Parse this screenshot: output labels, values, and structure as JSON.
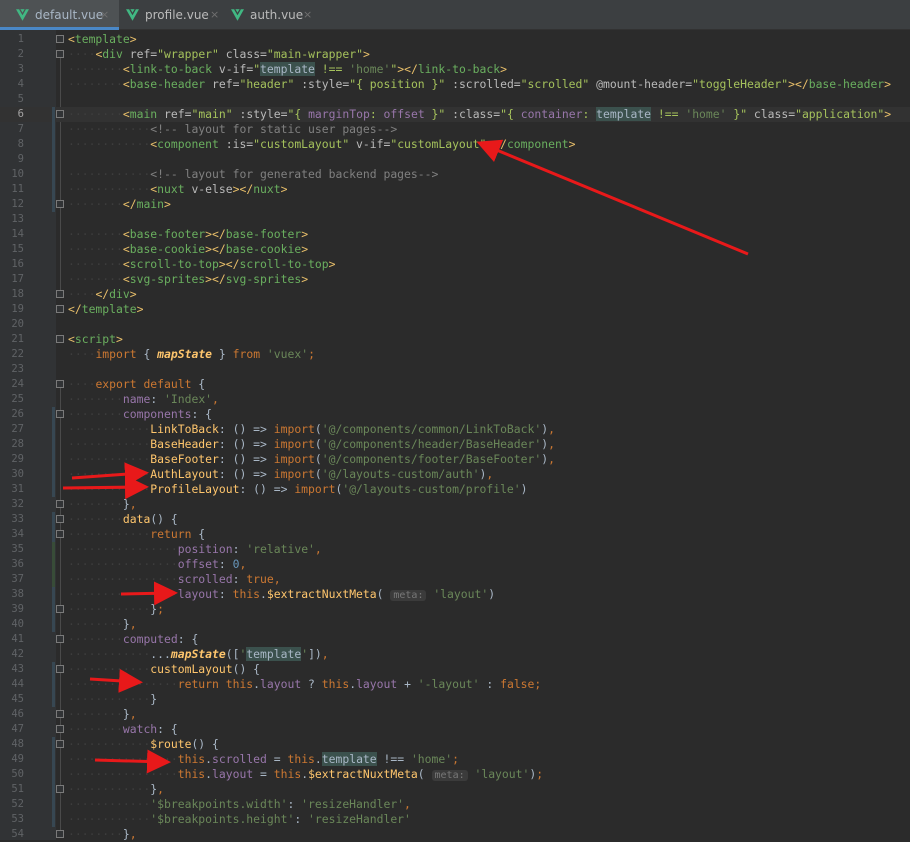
{
  "tabs": [
    {
      "label": "default.vue",
      "active": true
    },
    {
      "label": "profile.vue",
      "active": false
    },
    {
      "label": "auth.vue",
      "active": false
    }
  ],
  "close_glyph": "×",
  "colors": {
    "accent": "#4a88c7",
    "vue_green": "#41b883",
    "arrow": "#e8191a"
  },
  "editor": {
    "line_numbers": [
      "1",
      "2",
      "3",
      "4",
      "5",
      "6",
      "7",
      "8",
      "9",
      "10",
      "11",
      "12",
      "13",
      "14",
      "15",
      "16",
      "17",
      "18",
      "19",
      "20",
      "21",
      "22",
      "23",
      "24",
      "25",
      "26",
      "27",
      "28",
      "29",
      "30",
      "31",
      "32",
      "33",
      "34",
      "35",
      "36",
      "37",
      "38",
      "39",
      "40",
      "41",
      "42",
      "43",
      "44",
      "45",
      "46",
      "47",
      "48",
      "49",
      "50",
      "51",
      "52",
      "53",
      "54"
    ],
    "lines": [
      [
        [
          "tg",
          "<"
        ],
        [
          "tgn",
          "template"
        ],
        [
          "tg",
          ">"
        ]
      ],
      [
        [
          "ws",
          "····"
        ],
        [
          "tg",
          "<"
        ],
        [
          "tgn",
          "div "
        ],
        [
          "an",
          "ref="
        ],
        [
          "av",
          "\"wrapper\""
        ],
        [
          "an",
          " class="
        ],
        [
          "av",
          "\"main-wrapper\""
        ],
        [
          "tg",
          ">"
        ]
      ],
      [
        [
          "ws",
          "········"
        ],
        [
          "tg",
          "<"
        ],
        [
          "tgn",
          "link-to-back "
        ],
        [
          "an",
          "v-if="
        ],
        [
          "av",
          "\""
        ],
        [
          "hl",
          "template"
        ],
        [
          "av",
          " !== "
        ],
        [
          "st",
          "'home'"
        ],
        [
          "av",
          "\""
        ],
        [
          "tg",
          "></"
        ],
        [
          "tgn",
          "link-to-back"
        ],
        [
          "tg",
          ">"
        ]
      ],
      [
        [
          "ws",
          "········"
        ],
        [
          "tg",
          "<"
        ],
        [
          "tgn",
          "base-header "
        ],
        [
          "an",
          "ref="
        ],
        [
          "av",
          "\"header\""
        ],
        [
          "an",
          " :style="
        ],
        [
          "av",
          "\"{ position }\""
        ],
        [
          "an",
          " :scrolled="
        ],
        [
          "av",
          "\"scrolled\""
        ],
        [
          "an",
          " @mount-header="
        ],
        [
          "av",
          "\"toggleHeader\""
        ],
        [
          "tg",
          "></"
        ],
        [
          "tgn",
          "base-header"
        ],
        [
          "tg",
          ">"
        ]
      ],
      [],
      [
        [
          "ws",
          "········"
        ],
        [
          "tg",
          "<"
        ],
        [
          "tgn",
          "main "
        ],
        [
          "an",
          "ref="
        ],
        [
          "av",
          "\"main\""
        ],
        [
          "an",
          " :style="
        ],
        [
          "av",
          "\"{ "
        ],
        [
          "pr",
          "marginTop"
        ],
        [
          "av",
          ": "
        ],
        [
          "pr",
          "offset"
        ],
        [
          "av",
          " }\""
        ],
        [
          "an",
          " :class="
        ],
        [
          "av",
          "\"{ "
        ],
        [
          "pr",
          "container"
        ],
        [
          "av",
          ": "
        ],
        [
          "hl",
          "template"
        ],
        [
          "av",
          " !== "
        ],
        [
          "st",
          "'home'"
        ],
        [
          "av",
          " }\""
        ],
        [
          "an",
          " class="
        ],
        [
          "av",
          "\"application\""
        ],
        [
          "tg",
          ">"
        ]
      ],
      [
        [
          "ws",
          "············"
        ],
        [
          "cm",
          "<!-- layout for static user pages-->"
        ]
      ],
      [
        [
          "ws",
          "············"
        ],
        [
          "tg",
          "<"
        ],
        [
          "tgn",
          "component "
        ],
        [
          "an",
          ":is="
        ],
        [
          "av",
          "\"customLayout\""
        ],
        [
          "an",
          " v-if="
        ],
        [
          "av",
          "\"customLayout\""
        ],
        [
          "tg",
          "></"
        ],
        [
          "tgn",
          "component"
        ],
        [
          "tg",
          ">"
        ]
      ],
      [],
      [
        [
          "ws",
          "············"
        ],
        [
          "cm",
          "<!-- layout for generated backend pages-->"
        ]
      ],
      [
        [
          "ws",
          "············"
        ],
        [
          "tg",
          "<"
        ],
        [
          "tgn",
          "nuxt "
        ],
        [
          "an",
          "v-else"
        ],
        [
          "tg",
          "></"
        ],
        [
          "tgn",
          "nuxt"
        ],
        [
          "tg",
          ">"
        ]
      ],
      [
        [
          "ws",
          "········"
        ],
        [
          "tg",
          "</"
        ],
        [
          "tgn",
          "main"
        ],
        [
          "tg",
          ">"
        ]
      ],
      [],
      [
        [
          "ws",
          "········"
        ],
        [
          "tg",
          "<"
        ],
        [
          "tgn",
          "base-footer"
        ],
        [
          "tg",
          "></"
        ],
        [
          "tgn",
          "base-footer"
        ],
        [
          "tg",
          ">"
        ]
      ],
      [
        [
          "ws",
          "········"
        ],
        [
          "tg",
          "<"
        ],
        [
          "tgn",
          "base-cookie"
        ],
        [
          "tg",
          "></"
        ],
        [
          "tgn",
          "base-cookie"
        ],
        [
          "tg",
          ">"
        ]
      ],
      [
        [
          "ws",
          "········"
        ],
        [
          "tg",
          "<"
        ],
        [
          "tgn",
          "scroll-to-top"
        ],
        [
          "tg",
          "></"
        ],
        [
          "tgn",
          "scroll-to-top"
        ],
        [
          "tg",
          ">"
        ]
      ],
      [
        [
          "ws",
          "········"
        ],
        [
          "tg",
          "<"
        ],
        [
          "tgn",
          "svg-sprites"
        ],
        [
          "tg",
          "></"
        ],
        [
          "tgn",
          "svg-sprites"
        ],
        [
          "tg",
          ">"
        ]
      ],
      [
        [
          "ws",
          "····"
        ],
        [
          "tg",
          "</"
        ],
        [
          "tgn",
          "div"
        ],
        [
          "tg",
          ">"
        ]
      ],
      [
        [
          "tg",
          "</"
        ],
        [
          "tgn",
          "template"
        ],
        [
          "tg",
          ">"
        ]
      ],
      [],
      [
        [
          "tg",
          "<"
        ],
        [
          "tgn",
          "script"
        ],
        [
          "tg",
          ">"
        ]
      ],
      [
        [
          "ws",
          "····"
        ],
        [
          "kw",
          "import"
        ],
        [
          "tx",
          " { "
        ],
        [
          "it",
          "mapState"
        ],
        [
          "tx",
          " } "
        ],
        [
          "kw",
          "from"
        ],
        [
          "st",
          " 'vuex'"
        ],
        [
          "kw",
          ";"
        ]
      ],
      [],
      [
        [
          "ws",
          "····"
        ],
        [
          "kw",
          "export default"
        ],
        [
          "tx",
          " {"
        ]
      ],
      [
        [
          "ws",
          "········"
        ],
        [
          "pr",
          "name"
        ],
        [
          "tx",
          ": "
        ],
        [
          "st",
          "'Index'"
        ],
        [
          "kw",
          ","
        ]
      ],
      [
        [
          "ws",
          "········"
        ],
        [
          "pr",
          "components"
        ],
        [
          "tx",
          ": {"
        ]
      ],
      [
        [
          "ws",
          "············"
        ],
        [
          "fn",
          "LinkToBack"
        ],
        [
          "tx",
          ": () => "
        ],
        [
          "kw",
          "import"
        ],
        [
          "tx",
          "("
        ],
        [
          "st",
          "'@/components/common/LinkToBack'"
        ],
        [
          "tx",
          ")"
        ],
        [
          "kw",
          ","
        ]
      ],
      [
        [
          "ws",
          "············"
        ],
        [
          "fn",
          "BaseHeader"
        ],
        [
          "tx",
          ": () => "
        ],
        [
          "kw",
          "import"
        ],
        [
          "tx",
          "("
        ],
        [
          "st",
          "'@/components/header/BaseHeader'"
        ],
        [
          "tx",
          ")"
        ],
        [
          "kw",
          ","
        ]
      ],
      [
        [
          "ws",
          "············"
        ],
        [
          "fn",
          "BaseFooter"
        ],
        [
          "tx",
          ": () => "
        ],
        [
          "kw",
          "import"
        ],
        [
          "tx",
          "("
        ],
        [
          "st",
          "'@/components/footer/BaseFooter'"
        ],
        [
          "tx",
          ")"
        ],
        [
          "kw",
          ","
        ]
      ],
      [
        [
          "ws",
          "············"
        ],
        [
          "fn",
          "AuthLayout"
        ],
        [
          "tx",
          ": () => "
        ],
        [
          "kw",
          "import"
        ],
        [
          "tx",
          "("
        ],
        [
          "st",
          "'@/layouts-custom/auth'"
        ],
        [
          "tx",
          ")"
        ],
        [
          "kw",
          ","
        ]
      ],
      [
        [
          "ws",
          "············"
        ],
        [
          "fn",
          "ProfileLayout"
        ],
        [
          "tx",
          ": () => "
        ],
        [
          "kw",
          "import"
        ],
        [
          "tx",
          "("
        ],
        [
          "st",
          "'@/layouts-custom/profile'"
        ],
        [
          "tx",
          ")"
        ]
      ],
      [
        [
          "ws",
          "········"
        ],
        [
          "tx",
          "}"
        ],
        [
          "kw",
          ","
        ]
      ],
      [
        [
          "ws",
          "········"
        ],
        [
          "fn",
          "data"
        ],
        [
          "tx",
          "() {"
        ]
      ],
      [
        [
          "ws",
          "············"
        ],
        [
          "kw",
          "return"
        ],
        [
          "tx",
          " {"
        ]
      ],
      [
        [
          "ws",
          "················"
        ],
        [
          "pr",
          "position"
        ],
        [
          "tx",
          ": "
        ],
        [
          "st",
          "'relative'"
        ],
        [
          "kw",
          ","
        ]
      ],
      [
        [
          "ws",
          "················"
        ],
        [
          "pr",
          "offset"
        ],
        [
          "tx",
          ": "
        ],
        [
          "nm",
          "0"
        ],
        [
          "kw",
          ","
        ]
      ],
      [
        [
          "ws",
          "················"
        ],
        [
          "pr",
          "scrolled"
        ],
        [
          "tx",
          ": "
        ],
        [
          "kw",
          "true"
        ],
        [
          "kw",
          ","
        ]
      ],
      [
        [
          "ws",
          "················"
        ],
        [
          "pr",
          "layout"
        ],
        [
          "tx",
          ": "
        ],
        [
          "kw",
          "this"
        ],
        [
          "tx",
          "."
        ],
        [
          "fn",
          "$extractNuxtMeta"
        ],
        [
          "tx",
          "( "
        ],
        [
          "hint",
          "meta:"
        ],
        [
          "st",
          " 'layout'"
        ],
        [
          "tx",
          ")"
        ]
      ],
      [
        [
          "ws",
          "············"
        ],
        [
          "tx",
          "}"
        ],
        [
          "kw",
          ";"
        ]
      ],
      [
        [
          "ws",
          "········"
        ],
        [
          "tx",
          "}"
        ],
        [
          "kw",
          ","
        ]
      ],
      [
        [
          "ws",
          "········"
        ],
        [
          "pr",
          "computed"
        ],
        [
          "tx",
          ": {"
        ]
      ],
      [
        [
          "ws",
          "············"
        ],
        [
          "tx",
          "..."
        ],
        [
          "it",
          "mapState"
        ],
        [
          "tx",
          "(["
        ],
        [
          "st",
          "'"
        ],
        [
          "hl",
          "template"
        ],
        [
          "st",
          "'"
        ],
        [
          "tx",
          "])"
        ],
        [
          "kw",
          ","
        ]
      ],
      [
        [
          "ws",
          "············"
        ],
        [
          "fn",
          "customLayout"
        ],
        [
          "tx",
          "() {"
        ]
      ],
      [
        [
          "ws",
          "················"
        ],
        [
          "kw",
          "return this"
        ],
        [
          "tx",
          "."
        ],
        [
          "pr",
          "layout"
        ],
        [
          "tx",
          " ? "
        ],
        [
          "kw",
          "this"
        ],
        [
          "tx",
          "."
        ],
        [
          "pr",
          "layout"
        ],
        [
          "tx",
          " + "
        ],
        [
          "st",
          "'-layout'"
        ],
        [
          "tx",
          " : "
        ],
        [
          "kw",
          "false;"
        ]
      ],
      [
        [
          "ws",
          "············"
        ],
        [
          "tx",
          "}"
        ]
      ],
      [
        [
          "ws",
          "········"
        ],
        [
          "tx",
          "}"
        ],
        [
          "kw",
          ","
        ]
      ],
      [
        [
          "ws",
          "········"
        ],
        [
          "pr",
          "watch"
        ],
        [
          "tx",
          ": {"
        ]
      ],
      [
        [
          "ws",
          "············"
        ],
        [
          "fn",
          "$route"
        ],
        [
          "tx",
          "() {"
        ]
      ],
      [
        [
          "ws",
          "················"
        ],
        [
          "kw",
          "this"
        ],
        [
          "tx",
          "."
        ],
        [
          "pr",
          "scrolled"
        ],
        [
          "tx",
          " = "
        ],
        [
          "kw",
          "this"
        ],
        [
          "tx",
          "."
        ],
        [
          "hl",
          "template"
        ],
        [
          "tx",
          " !== "
        ],
        [
          "st",
          "'home'"
        ],
        [
          "kw",
          ";"
        ]
      ],
      [
        [
          "ws",
          "················"
        ],
        [
          "kw",
          "this"
        ],
        [
          "tx",
          "."
        ],
        [
          "pr",
          "layout"
        ],
        [
          "tx",
          " = "
        ],
        [
          "kw",
          "this"
        ],
        [
          "tx",
          "."
        ],
        [
          "fn",
          "$extractNuxtMeta"
        ],
        [
          "tx",
          "( "
        ],
        [
          "hint",
          "meta:"
        ],
        [
          "st",
          " 'layout'"
        ],
        [
          "tx",
          ")"
        ],
        [
          "kw",
          ";"
        ]
      ],
      [
        [
          "ws",
          "············"
        ],
        [
          "tx",
          "}"
        ],
        [
          "kw",
          ","
        ]
      ],
      [
        [
          "ws",
          "············"
        ],
        [
          "st",
          "'$breakpoints.width'"
        ],
        [
          "tx",
          ": "
        ],
        [
          "st",
          "'resizeHandler'"
        ],
        [
          "kw",
          ","
        ]
      ],
      [
        [
          "ws",
          "············"
        ],
        [
          "st",
          "'$breakpoints.height'"
        ],
        [
          "tx",
          ": "
        ],
        [
          "st",
          "'resizeHandler'"
        ]
      ],
      [
        [
          "ws",
          "········"
        ],
        [
          "tx",
          "}"
        ],
        [
          "kw",
          ","
        ]
      ]
    ]
  }
}
